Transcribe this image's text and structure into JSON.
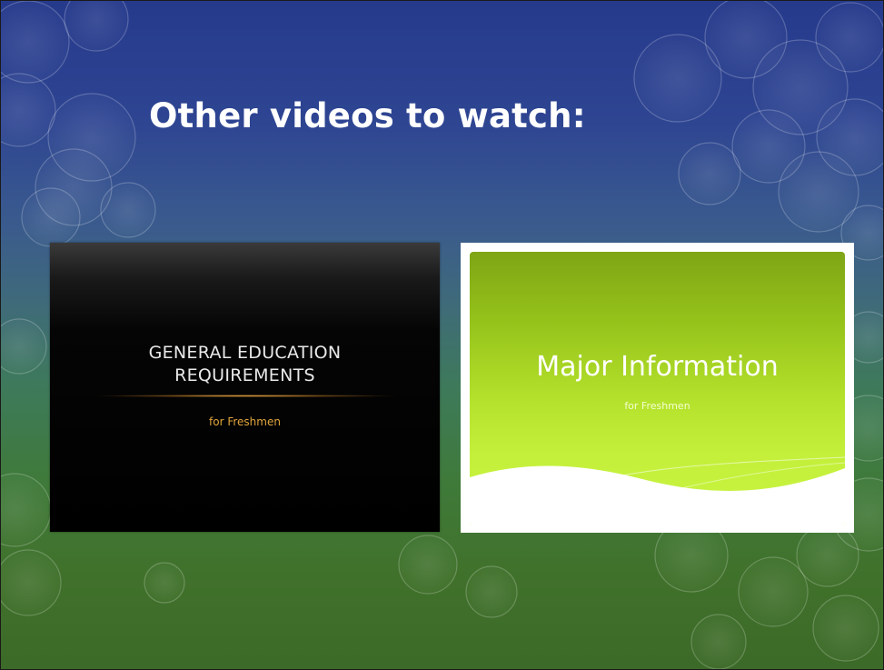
{
  "slide": {
    "title": "Other videos to watch:"
  },
  "videos": [
    {
      "title": "GENERAL EDUCATION\nREQUIREMENTS",
      "subtitle": "for Freshmen",
      "accent_color": "#e0a43c"
    },
    {
      "title": "Major Information",
      "subtitle": "for Freshmen",
      "accent_color": "#b5e22c"
    }
  ],
  "colors": {
    "background_top": "#263a8c",
    "background_bottom": "#3c6a28",
    "title_text": "#ffffff"
  }
}
